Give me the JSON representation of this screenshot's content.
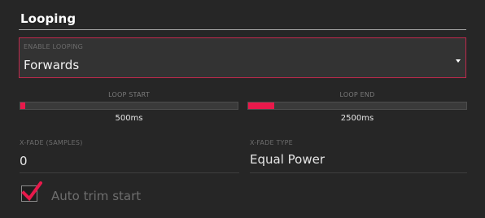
{
  "section": {
    "title": "Looping"
  },
  "enable_looping": {
    "caption": "ENABLE LOOPING",
    "value": "Forwards",
    "arrow_icon": "caret-down-icon"
  },
  "loop_start": {
    "label": "LOOP START",
    "value": "500ms",
    "position_fraction": 0.01
  },
  "loop_end": {
    "label": "LOOP END",
    "value": "2500ms",
    "position_fraction": 0.12
  },
  "xfade_samples": {
    "caption": "X-FADE (SAMPLES)",
    "value": "0"
  },
  "xfade_type": {
    "caption": "X-FADE TYPE",
    "value": "Equal Power"
  },
  "auto_trim": {
    "label": "Auto trim start",
    "checked": true,
    "check_icon": "checkmark-icon"
  },
  "colors": {
    "accent": "#e8194b",
    "background": "#262626",
    "dropdown_border": "#c0294c"
  }
}
